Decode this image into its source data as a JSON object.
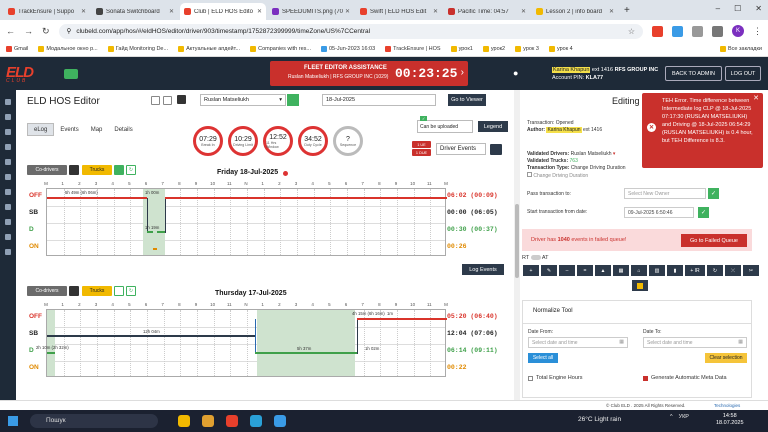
{
  "browser": {
    "tabs": [
      {
        "label": "TrackEnsure | Suppo",
        "color": "#e8402c"
      },
      {
        "label": "Sonata Switchboard",
        "color": "#444"
      },
      {
        "label": "Club | ELD HOS Edito",
        "color": "#e8402c"
      },
      {
        "label": "SPEEDUMITS.png (70",
        "color": "#7b2fbf"
      },
      {
        "label": "Swift | ELD HOS Edit",
        "color": "#e8402c"
      },
      {
        "label": "Pacific Time: 04:57",
        "color": "#c9302c"
      },
      {
        "label": "Lesson 2 | info board",
        "color": "#f1b900"
      }
    ],
    "new_tab": "+",
    "window_controls": [
      "–",
      "☐",
      "✕"
    ],
    "url": "clubeld.com/app/hos/#/eldHOS/editor/driver/903/timestamp/1752872399999/timeZone/US%7CCentral",
    "avatar_letter": "K",
    "bookmarks": [
      "Gmail",
      "Модальное окно p...",
      "Гайд Monitoring De...",
      "Актуальные апдейт...",
      "Companies with res...",
      "05-Jun-2023 16:03",
      "TrackEnsure | HOS",
      "урок1",
      "урок2",
      "урок 3",
      "урок 4",
      "Все закладки"
    ]
  },
  "header": {
    "logo": "ELD",
    "logo_sub": "CLUB",
    "fleet_title": "FLEET EDITOR ASSISTANCE",
    "fleet_sub": "Ruslan Matseliukh  |  RFS GROUP INC (1029)",
    "timer": "00:23:25",
    "user_name": "Karina Khapun",
    "user_ext": "ext 1416",
    "company": "RFS GROUP INC",
    "account_pin_label": "Account PIN:",
    "account_pin": "KLA77",
    "back_to_admin": "BACK TO ADMIN",
    "logout": "LOG OUT"
  },
  "toolbar": {
    "title": "ELD HOS Editor",
    "driver": "Ruslan Matseliukh",
    "date": "18-Jul-2025",
    "goto_viewer": "Go to Viewer",
    "tabs": [
      "eLog",
      "Events",
      "Map",
      "Details"
    ],
    "can_be_uploaded": "Can be uploaded",
    "legend": "Legend",
    "driver_events": "Driver Events",
    "badge1": "1 UE",
    "badge2": "1 DUE"
  },
  "clocks": [
    {
      "value": "07:29",
      "label": "Break In",
      "color": "red"
    },
    {
      "value": "10:29",
      "label": "Driving Limit",
      "color": "red"
    },
    {
      "value": "12:52",
      "label": "11 Hrs Window",
      "color": "red"
    },
    {
      "value": "34:52",
      "label": "Duty Cycle",
      "color": "red"
    },
    {
      "value": "?",
      "label": "Sequence",
      "color": "grey"
    }
  ],
  "day_controls": {
    "codrivers": "Co-drivers",
    "trucks": "Trucks"
  },
  "hour_ticks": [
    "M",
    "1",
    "2",
    "3",
    "4",
    "5",
    "6",
    "7",
    "8",
    "9",
    "10",
    "11",
    "N",
    "1",
    "2",
    "3",
    "4",
    "5",
    "6",
    "7",
    "8",
    "9",
    "10",
    "11",
    "M"
  ],
  "day1": {
    "title": "Friday 18-Jul-2025",
    "statuses": [
      {
        "code": "OFF",
        "total": "06:02 (00:09)",
        "color": "#d9342b"
      },
      {
        "code": "SB",
        "total": "00:00 (06:05)",
        "color": "#222"
      },
      {
        "code": "D",
        "total": "00:30 (00:37)",
        "color": "#3fa04a"
      },
      {
        "code": "ON",
        "total": "00:26",
        "color": "#e08a00"
      }
    ],
    "seg_labels": [
      "5h 49m (6h 06m)",
      "1h 19m",
      "1h 00m"
    ],
    "log_events": "Log Events"
  },
  "day2": {
    "title": "Thursday 17-Jul-2025",
    "statuses": [
      {
        "code": "OFF",
        "total": "05:20 (06:40)",
        "color": "#d9342b"
      },
      {
        "code": "SB",
        "total": "12:04 (07:06)",
        "color": "#222"
      },
      {
        "code": "D",
        "total": "06:14 (09:11)",
        "color": "#3fa04a"
      },
      {
        "code": "ON",
        "total": "00:22",
        "color": "#e08a00"
      }
    ],
    "seg_labels": [
      "12h 04m",
      "2h 10m (2h 32m)",
      "5h 37m",
      "4h 16m",
      "3h 05m",
      "1h 02m",
      "4h 15m (6h 16m)",
      "1m"
    ]
  },
  "right_panel": {
    "title": "Editing",
    "tx_status_label": "Transaction:",
    "tx_status": "Opened",
    "author_label": "Author:",
    "author": "Karina Khapun",
    "author_ext": "ext 1416",
    "validated_drivers_label": "Validated Drivers:",
    "validated_drivers": "Ruslan Matseliukh",
    "validated_trucks_label": "Validated Trucks:",
    "validated_trucks": "763",
    "tx_type_label": "Transaction Type:",
    "tx_type": "Change Driving Duration",
    "change_driving_duration": "Change Driving Duration",
    "pass_to_label": "Pass transaction to:",
    "pass_to_placeholder": "Select New Owner",
    "start_from_label": "Start transaction from date:",
    "start_from": "09-Jul-2025 6:50:46",
    "failed_msg_pre": "Driver has ",
    "failed_count": "1040",
    "failed_msg_post": " events in failed queue!",
    "goto_failed": "Go to Failed Queue",
    "rt": "RT",
    "at": "AT",
    "tools": [
      "+",
      "✎",
      "–",
      "=",
      "▲",
      "▦",
      "⌂",
      "▥",
      "▮",
      "+ IR",
      "↻",
      "⤫",
      "✂"
    ],
    "normalize_title": "Normalize Tool",
    "date_from_label": "Date From:",
    "date_to_label": "Date To:",
    "date_placeholder": "Select date and time",
    "select_all": "Select all",
    "clear_selection": "Clear selection",
    "total_engine_hours": "Total Engine Hours",
    "generate_meta": "Generate Automatic Meta Data"
  },
  "toast": {
    "text": "TEH Error. Time difference between Intermediate log CLP @ 18-Jul-2025 07:17:30 (RUSLAN MATSELIUKH) and Driving @ 18-Jul-2025 06:54:29 (RUSLAN MATSELIUKH) is 0.4 hour, but TEH Difference is 8.3."
  },
  "footer": {
    "copyright": "© Club ELD . 2025 All Rights Reserved.",
    "powered": "Technologies"
  },
  "taskbar": {
    "search": "Пошук",
    "weather": "26°C  Light rain",
    "lang": "УКР",
    "time": "14:58",
    "date": "18.07.2025"
  }
}
